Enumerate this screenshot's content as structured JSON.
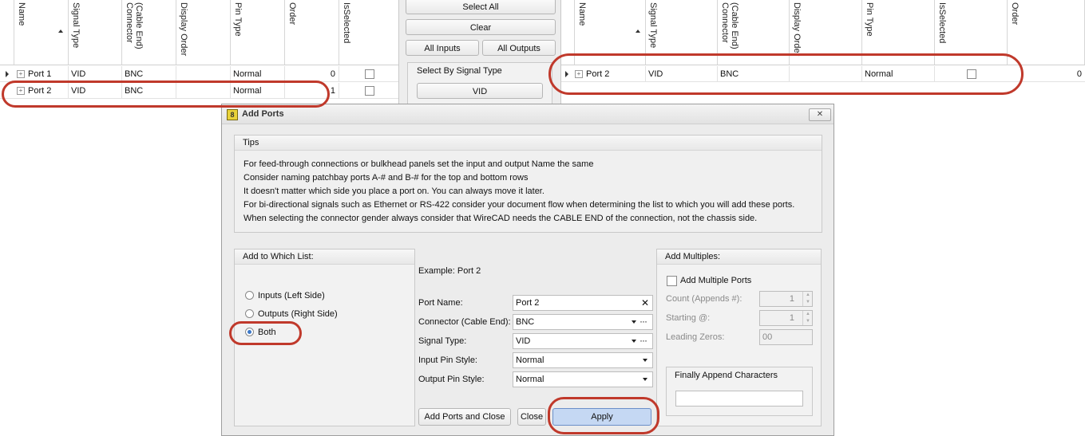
{
  "left_grid": {
    "columns": [
      "Name",
      "Signal Type",
      "(Cable End)\nConnector",
      "Display Order",
      "Pin Type",
      "Order",
      "IsSelected"
    ],
    "rows": [
      {
        "name": "Port 1",
        "signal_type": "VID",
        "connector": "BNC",
        "display_order": "",
        "pin_type": "Normal",
        "order": "0"
      },
      {
        "name": "Port 2",
        "signal_type": "VID",
        "connector": "BNC",
        "display_order": "",
        "pin_type": "Normal",
        "order": "1"
      }
    ]
  },
  "middle": {
    "select_all": "Select All",
    "clear": "Clear",
    "all_inputs": "All Inputs",
    "all_outputs": "All Outputs",
    "select_by_signal_type": "Select By Signal Type",
    "vid": "VID"
  },
  "right_grid": {
    "columns": [
      "Name",
      "Signal Type",
      "(Cable End)\nConnector",
      "Display Order",
      "Pin Type",
      "IsSelected",
      "Order"
    ],
    "rows": [
      {
        "name": "Port 2",
        "signal_type": "VID",
        "connector": "BNC",
        "display_order": "",
        "pin_type": "Normal",
        "order": "0"
      }
    ]
  },
  "dialog": {
    "title": "Add Ports",
    "tips_title": "Tips",
    "tips": [
      "For feed-through connections or bulkhead panels set the input and output Name the same",
      "Consider naming patchbay ports A-# and B-# for the top and bottom rows",
      "It doesn't matter which side you place a port on. You can always move it later.",
      "For bi-directional signals such as Ethernet or RS-422 consider your document flow when determining the list to which you will add these ports.",
      "When selecting the connector gender always consider that WireCAD needs the CABLE END of the connection, not the chassis side."
    ],
    "add_to_list_title": "Add to Which List:",
    "radio_inputs": "Inputs (Left Side)",
    "radio_outputs": "Outputs (Right Side)",
    "radio_both": "Both",
    "example": "Example: Port 2",
    "port_name_label": "Port Name:",
    "port_name_value": "Port 2",
    "connector_label": "Connector (Cable End):",
    "connector_value": "BNC",
    "signal_type_label": "Signal Type:",
    "signal_type_value": "VID",
    "input_pin_label": "Input Pin Style:",
    "input_pin_value": "Normal",
    "output_pin_label": "Output Pin Style:",
    "output_pin_value": "Normal",
    "add_multiples_title": "Add Multiples:",
    "add_multiple_ports": "Add Multiple Ports",
    "count_label": "Count (Appends #):",
    "count_value": "1",
    "starting_label": "Starting @:",
    "starting_value": "1",
    "leading_zeros_label": "Leading Zeros:",
    "leading_zeros_value": "00",
    "finally_append_title": "Finally Append Characters",
    "finally_append_value": "",
    "add_and_close": "Add Ports and Close",
    "close": "Close",
    "apply": "Apply",
    "close_x": "✕"
  },
  "colors": {
    "highlight": "#c0392b",
    "apply_bg": "#c5d8f3"
  }
}
